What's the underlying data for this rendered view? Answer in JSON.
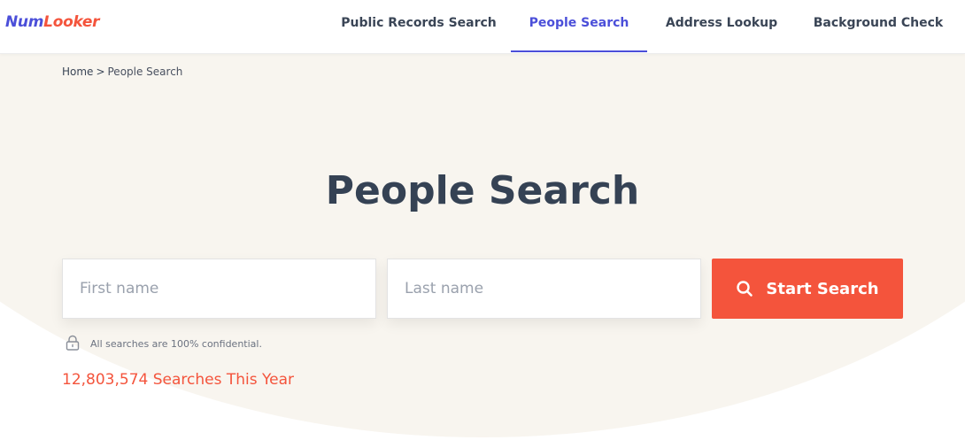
{
  "brand": {
    "logo_part1": "Num",
    "logo_part2": "Looker",
    "primary_color": "#4b4fd9",
    "accent_color": "#f4543c"
  },
  "nav": {
    "items": [
      {
        "label": "Public Records Search",
        "active": false
      },
      {
        "label": "People Search",
        "active": true
      },
      {
        "label": "Address Lookup",
        "active": false
      },
      {
        "label": "Background Check",
        "active": false
      }
    ]
  },
  "breadcrumb": {
    "home": "Home",
    "separator": ">",
    "current": "People Search"
  },
  "hero": {
    "title": "People Search",
    "background_color": "#f8f5ef"
  },
  "search": {
    "first_name": {
      "placeholder": "First name",
      "value": ""
    },
    "last_name": {
      "placeholder": "Last name",
      "value": ""
    },
    "button_label": "Start Search",
    "button_icon": "search-icon"
  },
  "confidential": {
    "icon": "lock-icon",
    "text": "All searches are 100% confidential."
  },
  "stats": {
    "searches_count": "12,803,574 Searches This Year"
  }
}
